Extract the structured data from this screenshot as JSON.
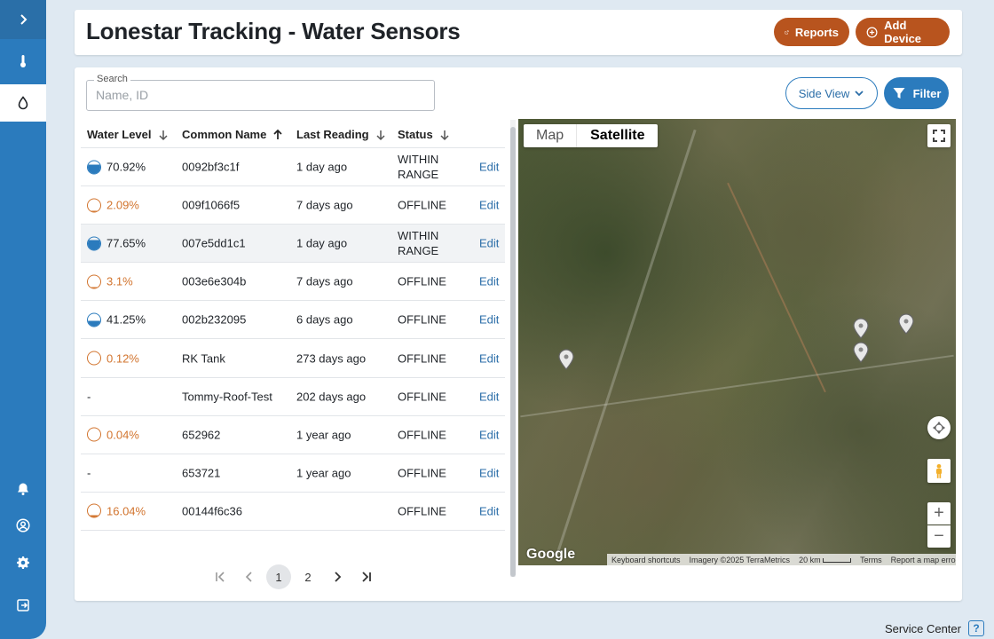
{
  "header": {
    "title": "Lonestar Tracking - Water Sensors",
    "reports_label": "Reports",
    "add_device_label": "Add Device"
  },
  "search": {
    "label": "Search",
    "placeholder": "Name, ID",
    "value": ""
  },
  "toolbar": {
    "side_view_label": "Side View",
    "filter_label": "Filter"
  },
  "table": {
    "columns": [
      {
        "label": "Water Level",
        "sort": "desc"
      },
      {
        "label": "Common Name",
        "sort": "asc"
      },
      {
        "label": "Last Reading",
        "sort": "desc"
      },
      {
        "label": "Status",
        "sort": "desc"
      }
    ],
    "rows": [
      {
        "level": "70.92%",
        "level_value": 0.7092,
        "low": false,
        "name": "0092bf3c1f",
        "last": "1 day ago",
        "status": "WITHIN RANGE",
        "action": "Edit"
      },
      {
        "level": "2.09%",
        "level_value": 0.0209,
        "low": true,
        "name": "009f1066f5",
        "last": "7 days ago",
        "status": "OFFLINE",
        "action": "Edit"
      },
      {
        "level": "77.65%",
        "level_value": 0.7765,
        "low": false,
        "name": "007e5dd1c1",
        "last": "1 day ago",
        "status": "WITHIN RANGE",
        "action": "Edit",
        "highlight": true
      },
      {
        "level": "3.1%",
        "level_value": 0.031,
        "low": true,
        "name": "003e6e304b",
        "last": "7 days ago",
        "status": "OFFLINE",
        "action": "Edit"
      },
      {
        "level": "41.25%",
        "level_value": 0.4125,
        "low": false,
        "name": "002b232095",
        "last": "6 days ago",
        "status": "OFFLINE",
        "action": "Edit"
      },
      {
        "level": "0.12%",
        "level_value": 0.0012,
        "low": true,
        "name": "RK Tank",
        "last": "273 days ago",
        "status": "OFFLINE",
        "action": "Edit"
      },
      {
        "level": "-",
        "level_value": null,
        "low": false,
        "name": "Tommy-Roof-Test",
        "last": "202 days ago",
        "status": "OFFLINE",
        "action": "Edit"
      },
      {
        "level": "0.04%",
        "level_value": 0.0004,
        "low": true,
        "name": "652962",
        "last": "1 year ago",
        "status": "OFFLINE",
        "action": "Edit"
      },
      {
        "level": "-",
        "level_value": null,
        "low": false,
        "name": "653721",
        "last": "1 year ago",
        "status": "OFFLINE",
        "action": "Edit"
      },
      {
        "level": "16.04%",
        "level_value": 0.1604,
        "low": true,
        "name": "00144f6c36",
        "last": "",
        "status": "OFFLINE",
        "action": "Edit"
      }
    ]
  },
  "pagination": {
    "pages": [
      "1",
      "2"
    ],
    "current": "1"
  },
  "map": {
    "tabs": [
      "Map",
      "Satellite"
    ],
    "selected_tab": "Satellite",
    "logo": "Google",
    "footer": {
      "shortcuts": "Keyboard shortcuts",
      "imagery": "Imagery ©2025 TerraMetrics",
      "scale": "20 km",
      "terms": "Terms",
      "report": "Report a map error"
    },
    "zoom_in": "+",
    "zoom_out": "−"
  },
  "footer": {
    "service_center": "Service Center",
    "help_glyph": "?"
  },
  "colors": {
    "primary": "#2b7bbd",
    "accent": "#b8541e",
    "low_level": "#d2742e"
  }
}
